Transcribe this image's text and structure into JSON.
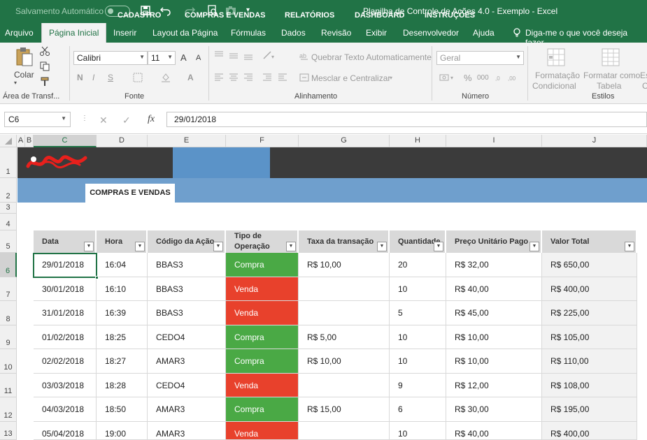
{
  "titlebar": {
    "autosave_label": "Salvamento Automático",
    "title": "Planilha de Controle de Ações 4.0 - Exemplo  -  Excel",
    "icons": [
      "save-icon",
      "undo-icon",
      "redo-icon",
      "print-preview-icon",
      "camera-icon",
      "customize-icon"
    ]
  },
  "ribbon_tabs": [
    "Arquivo",
    "Página Inicial",
    "Inserir",
    "Layout da Página",
    "Fórmulas",
    "Dados",
    "Revisão",
    "Exibir",
    "Desenvolvedor",
    "Ajuda"
  ],
  "tell_me": "Diga-me o que você deseja fazer",
  "ribbon": {
    "paste_label": "Colar",
    "clipboard_group": "Área de Transf...",
    "font_name": "Calibri",
    "font_size": "11",
    "font_group": "Fonte",
    "wrap_text": "Quebrar Texto Automaticamente",
    "merge_center": "Mesclar e Centralizar",
    "alignment_group": "Alinhamento",
    "number_format": "Geral",
    "number_group": "Número",
    "conditional_format_1": "Formatação",
    "conditional_format_2": "Condicional",
    "format_table_1": "Formatar como",
    "format_table_2": "Tabela",
    "styles_group": "Estilos",
    "style_partial_1": "Es",
    "style_partial_2": "C",
    "bold": "N",
    "italic": "I",
    "underline": "S",
    "grow_font": "A",
    "shrink_font": "A",
    "percent": "%",
    "thousands": "000"
  },
  "formula_bar": {
    "name_box": "C6",
    "fx": "fx",
    "value": "29/01/2018"
  },
  "columns": [
    "A",
    "B",
    "C",
    "D",
    "E",
    "F",
    "G",
    "H",
    "I",
    "J"
  ],
  "rows": [
    "1",
    "2",
    "3",
    "4",
    "5",
    "6",
    "7",
    "8",
    "9",
    "10",
    "11",
    "12",
    "13"
  ],
  "nav": {
    "items": [
      "CADASTRO",
      "COMPRAS E VENDAS",
      "RELATÓRIOS",
      "DASHBOARD",
      "INSTRUÇÕES"
    ],
    "subtab": "COMPRAS E VENDAS"
  },
  "table": {
    "headers": [
      "Data",
      "Hora",
      "Código da Ação",
      "Tipo de Operação",
      "Taxa da transação",
      "Quantidade",
      "Preço Unitário Pago",
      "Valor Total"
    ],
    "tipo_header_line1": "Tipo de",
    "tipo_header_line2": "Operação",
    "rows": [
      [
        "29/01/2018",
        "16:04",
        "BBAS3",
        "Compra",
        "R$ 10,00",
        "20",
        "R$ 32,00",
        "R$ 650,00"
      ],
      [
        "30/01/2018",
        "16:10",
        "BBAS3",
        "Venda",
        "",
        "10",
        "R$ 40,00",
        "R$ 400,00"
      ],
      [
        "31/01/2018",
        "16:39",
        "BBAS3",
        "Venda",
        "",
        "5",
        "R$ 45,00",
        "R$ 225,00"
      ],
      [
        "01/02/2018",
        "18:25",
        "CEDO4",
        "Compra",
        "R$ 5,00",
        "10",
        "R$ 10,00",
        "R$ 105,00"
      ],
      [
        "02/02/2018",
        "18:27",
        "AMAR3",
        "Compra",
        "R$ 10,00",
        "10",
        "R$ 10,00",
        "R$ 110,00"
      ],
      [
        "03/03/2018",
        "18:28",
        "CEDO4",
        "Venda",
        "",
        "9",
        "R$ 12,00",
        "R$ 108,00"
      ],
      [
        "04/03/2018",
        "18:50",
        "AMAR3",
        "Compra",
        "R$ 15,00",
        "6",
        "R$ 30,00",
        "R$ 195,00"
      ],
      [
        "05/04/2018",
        "19:00",
        "AMAR3",
        "Venda",
        "",
        "10",
        "R$ 40,00",
        "R$ 400,00"
      ]
    ]
  },
  "colors": {
    "excel_green": "#217346",
    "nav_dark": "#3b3b3b",
    "nav_active": "#5b93c8",
    "subbar": "#6f9fcd",
    "compra": "#4aa945",
    "venda": "#e8412c"
  }
}
